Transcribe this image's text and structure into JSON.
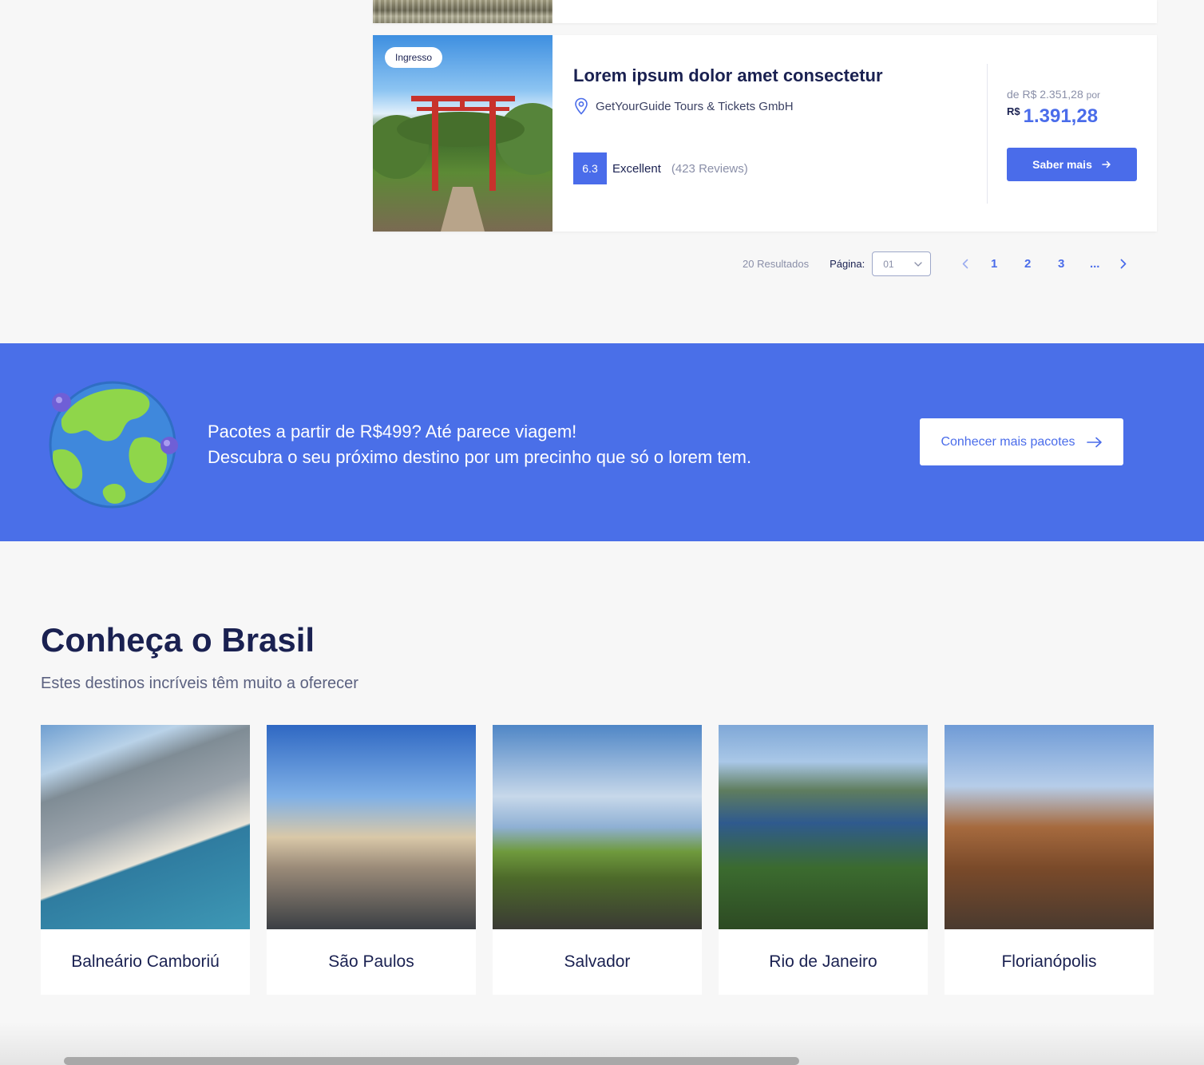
{
  "product": {
    "tag": "Ingresso",
    "title": "Lorem ipsum dolor amet consectetur",
    "provider": "GetYourGuide Tours & Tickets GmbH",
    "score": "6.3",
    "rating_label": "Excellent",
    "reviews": "(423 Reviews)",
    "price_old_prefix": "de R$ 2.351,28",
    "price_old_suffix": "por",
    "currency": "R$",
    "price": "1.391,28",
    "cta": "Saber mais"
  },
  "pagination": {
    "results": "20 Resultados",
    "page_label": "Página:",
    "selected_page": "01",
    "pages": [
      "1",
      "2",
      "3",
      "..."
    ]
  },
  "banner": {
    "line1": "Pacotes a partir de R$499? Até parece viagem!",
    "line2": "Descubra o seu próximo destino por um precinho que só o lorem tem.",
    "cta": "Conhecer mais pacotes"
  },
  "brasil": {
    "title": "Conheça o Brasil",
    "subtitle": "Estes destinos incríveis têm muito a oferecer",
    "destinations": [
      {
        "name": "Balneário Camboriú"
      },
      {
        "name": "São Paulos"
      },
      {
        "name": "Salvador"
      },
      {
        "name": "Rio de Janeiro"
      },
      {
        "name": "Florianópolis"
      }
    ]
  },
  "colors": {
    "accent": "#4a6cea",
    "banner": "#4a6fe8",
    "navy": "#1a2151"
  },
  "icons": [
    "location-pin-icon",
    "arrow-right-icon",
    "chevron-down-icon",
    "chevron-left-icon",
    "chevron-right-icon",
    "globe-illustration"
  ]
}
